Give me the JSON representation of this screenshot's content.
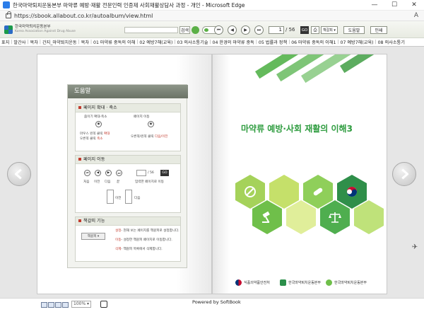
{
  "window": {
    "title": "한국마약퇴치운동본부 마약류 예방·재활 전문인력 인증제 사회재활상담사 과정 - 개인 - Microsoft Edge",
    "minimize": "—",
    "maximize": "☐",
    "close": "✕"
  },
  "address": {
    "url": "https://sbook.allabout.co.kr/autoalbum/view.html",
    "read_aloud": "A"
  },
  "header": {
    "logo_name": "한국마약퇴치운동본부",
    "logo_sub": "Korea Association Against Drug Abuse",
    "search_button": "검색",
    "first": "⏮",
    "prev": "◀",
    "next": "▶",
    "last": "⏭",
    "page_current": "1",
    "page_total": "/ 56",
    "go": "GO",
    "print": "⎙",
    "bookmark_select": "책갈피 ▾",
    "help": "도움말",
    "print_label": "인쇄"
  },
  "toc": [
    "표지",
    "발간사",
    "목차",
    "간지_마약퇴치운동",
    "목차",
    "01 마약류 중독의 이해",
    "02 예방7해(교육)",
    "03 의사소통기술",
    "04 한경의 마약류 중독",
    "05 법률과 정책",
    "06 마약류 중독의 이해1",
    "07 예방7해(교육)",
    "08 의사소통기"
  ],
  "help_panel": {
    "title": "도움말",
    "zoom_title": "페이지 확대 · 축소",
    "zoom_label": "줌이기 확대·축소",
    "move_label": "페이지 이동",
    "zoom_desc1": "마우스 왼쪽 클릭",
    "zoom_red1": "확대",
    "zoom_desc2": "오른쪽 클릭",
    "zoom_red2": "축소",
    "move_desc": "오른쪽/왼쪽 클릭",
    "move_red": "다음/이전",
    "nav_title": "페이지 이동",
    "nav_total": "/ 56",
    "nav_go": "GO",
    "nav_labels": [
      "처음",
      "이전",
      "다음",
      "끝",
      "입력한 페이지로 이동"
    ],
    "nav_prev": "이전",
    "nav_next": "다음",
    "bm_title": "책갈피 기능",
    "bm_select": "책갈피 ▾",
    "bm_line1_key": "설정",
    "bm_line1": "- 현재 보는 페이지를 책갈피로 설정합니다.",
    "bm_line2_key": "이동",
    "bm_line2": "- 설정한 책갈피 페이지로 이동합니다.",
    "bm_line3_key": "삭제",
    "bm_line3": "- 책갈피 목록에서 삭제합니다."
  },
  "cover": {
    "title": "마약류 예방·사회 재활의 이해3",
    "org1": "식품의약품안전처",
    "org2": "한국마약퇴치운동본부",
    "org3": "한국마약퇴치운동본부"
  },
  "status": {
    "zoom": "100% ▾",
    "powered": "Powered by SoftBook"
  },
  "colors": {
    "accent_green": "#53b24a",
    "title_green": "#2e9c3f",
    "hex_green": "#7fc24a",
    "hex_dark": "#2f8f4a"
  }
}
